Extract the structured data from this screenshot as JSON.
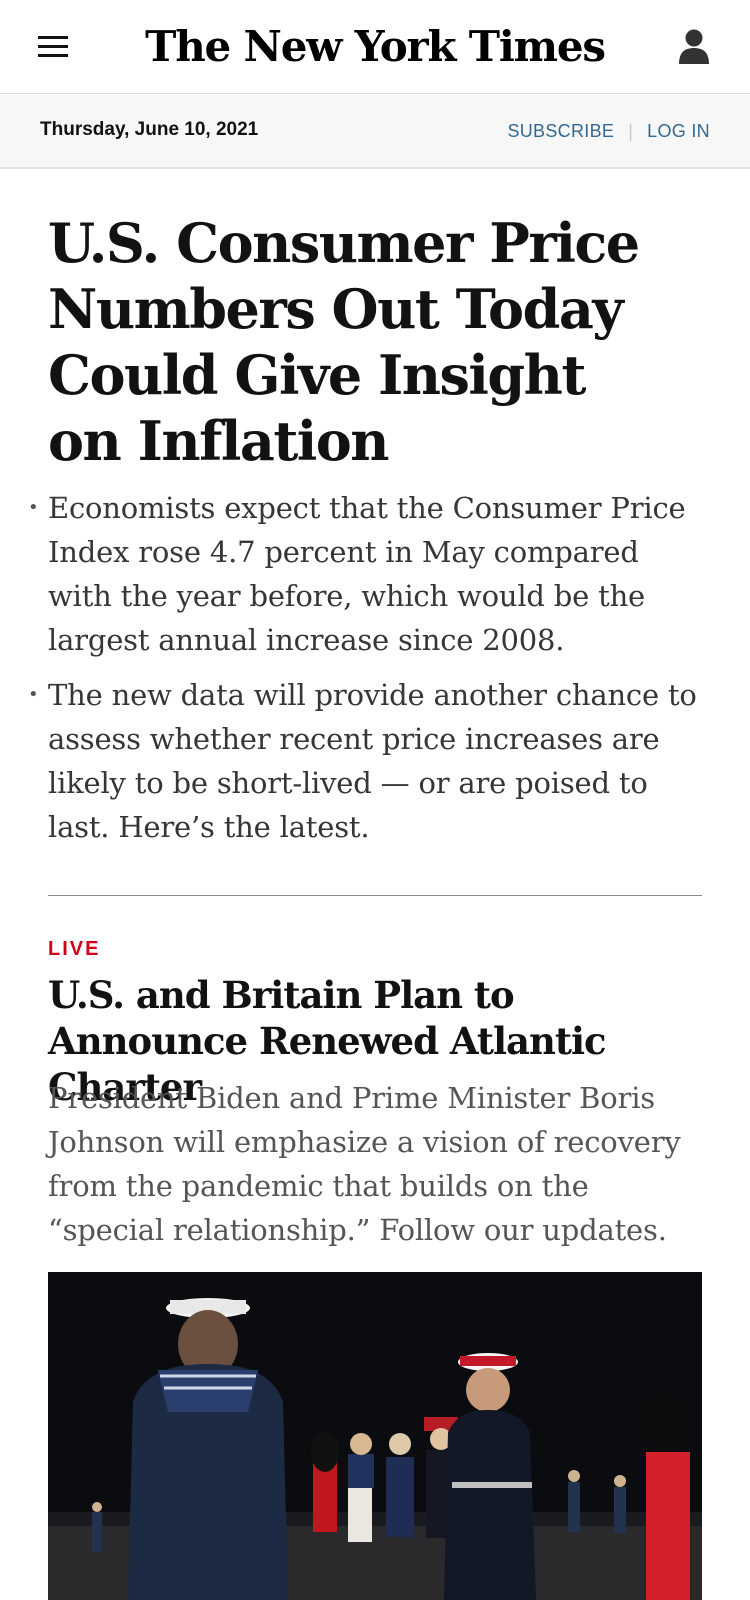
{
  "header": {
    "masthead": "The New York Times",
    "menu_icon": "hamburger-menu-icon",
    "account_icon": "person-icon"
  },
  "datebar": {
    "date": "Thursday, June 10, 2021",
    "subscribe_label": "SUBSCRIBE",
    "login_label": "LOG IN",
    "link_color": "#326891"
  },
  "lead_story": {
    "headline": "U.S. Consumer Price Numbers Out Today Could Give Insight on Inflation",
    "bullets": [
      "Economists expect that the Consumer Price Index rose 4.7 percent in May compared with the year before, which would be the largest annual increase since 2008.",
      "The new data will provide another chance to assess whether recent price increases are likely to be short-lived — or are poised to last. Here’s the latest."
    ]
  },
  "second_story": {
    "kicker": "LIVE",
    "kicker_color": "#d0021b",
    "headline": "U.S. and Britain Plan to Announce Renewed Atlantic Charter",
    "summary": "President Biden and Prime Minister Boris Johnson will emphasize a vision of recovery from the pandemic that builds on the “special relationship.” Follow our updates."
  }
}
